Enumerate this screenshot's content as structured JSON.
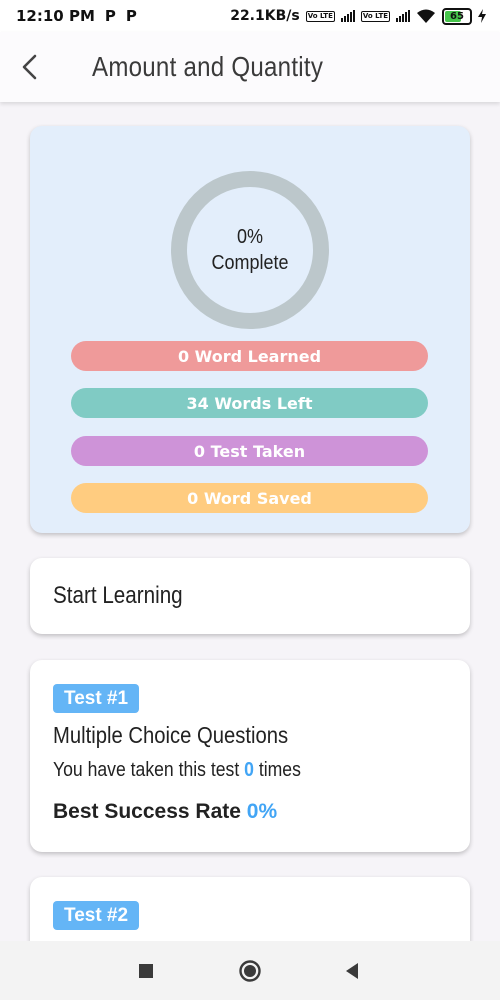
{
  "status_bar": {
    "time": "12:10 PM",
    "app_icons": [
      "P",
      "P"
    ],
    "net_speed": "22.1KB/s",
    "network_badge": "Vo LTE",
    "battery": "65"
  },
  "app_bar": {
    "title": "Amount and Quantity"
  },
  "progress": {
    "percent_label": "0%",
    "complete_label": "Complete",
    "percent_value": 0,
    "ring_color": "#bcc7cb",
    "stats": {
      "words_learned": "0 Word Learned",
      "words_left": "34 Words Left",
      "tests_taken": "0 Test Taken",
      "words_saved": "0 Word Saved"
    },
    "colors": {
      "words_learned": "#ef9a9a",
      "words_left": "#80cbc4",
      "tests_taken": "#ce93d8",
      "words_saved": "#ffcc80"
    }
  },
  "start_learning": {
    "label": "Start Learning"
  },
  "tests": [
    {
      "badge": "Test #1",
      "title": "Multiple Choice Questions",
      "taken_prefix": "You have taken this test",
      "taken_count": "0",
      "taken_suffix": "times",
      "rate_label": "Best Success Rate",
      "rate_value": "0%"
    },
    {
      "badge": "Test #2"
    }
  ],
  "accent_color": "#42a5f5",
  "nav_bar": {
    "icons": [
      "square-icon",
      "circle-icon",
      "triangle-back-icon"
    ]
  }
}
